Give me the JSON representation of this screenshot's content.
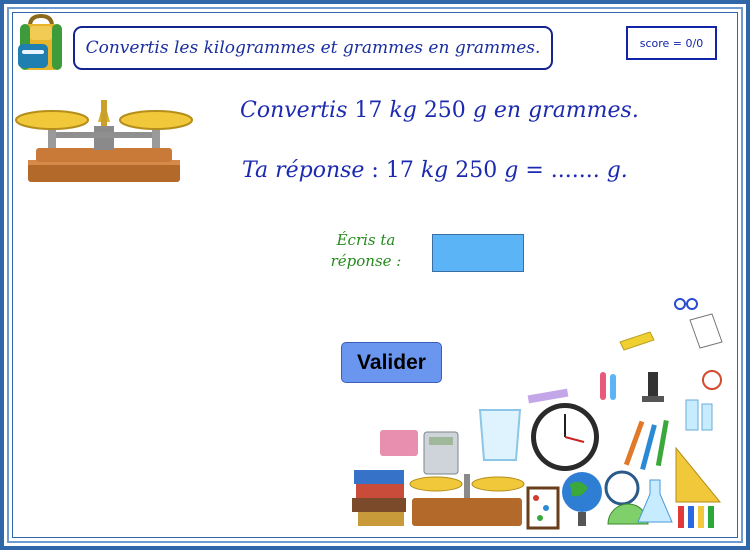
{
  "header": {
    "title": "Convertis les kilogrammes et grammes en grammes.",
    "score": "score = 0/0"
  },
  "exercise": {
    "question_prefix": "Convertis",
    "question_kg": "17",
    "question_kg_unit": "kg",
    "question_g": "250",
    "question_g_unit": "g",
    "question_suffix": "en grammes.",
    "answer_prefix": "Ta réponse",
    "answer_colon": " : ",
    "answer_kg": "17",
    "answer_kg_unit": "kg",
    "answer_g": "250",
    "answer_g_unit": "g",
    "answer_equals": " = ",
    "answer_blank": ".......",
    "answer_unit": "g."
  },
  "input": {
    "label_line1": "Écris ta",
    "label_line2": "réponse :",
    "value": "",
    "placeholder": ""
  },
  "buttons": {
    "validate_label": "Valider"
  },
  "images": {
    "backpack": "backpack-icon",
    "scale": "balance-scale-icon",
    "supplies": "school-supplies-collage"
  },
  "colors": {
    "frame": "#2f67a8",
    "title_border": "#14248f",
    "math_text": "#1c2ab0",
    "label_text": "#238a1c",
    "input_bg": "#5ab4f5",
    "button_bg": "#6b96ef"
  }
}
